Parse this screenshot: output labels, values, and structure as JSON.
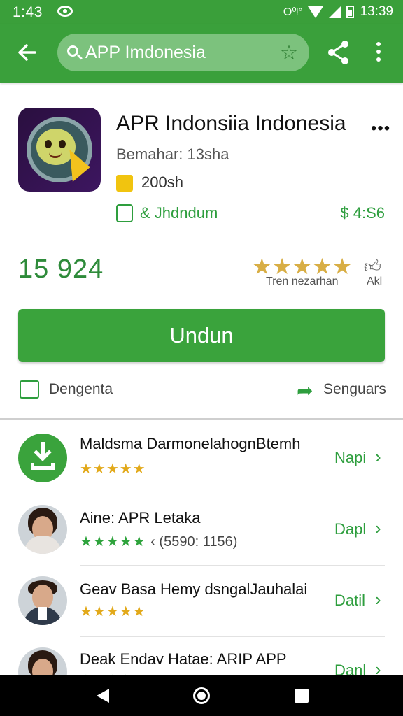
{
  "status_bar": {
    "time_left": "1:43",
    "right_glyphs": "O⁰ᵎᐤ",
    "time_right": "13:39"
  },
  "search": {
    "query": "APP Imdonesia"
  },
  "app": {
    "title": "APR Indonsiia Indonesia",
    "developer": "Bemahar: 13sha",
    "age_rating": "200sh",
    "category": "& Jhdndum",
    "price": "$ 4:S6",
    "rating_count": "15 924",
    "stars_caption": "Tren nezarhan",
    "stars_value": 4.5,
    "thumb_caption": "Akl",
    "install_label": "Undun",
    "action_left": "Dengenta",
    "action_right": "Senguars"
  },
  "list": [
    {
      "title": "Maldsma DarmonelahognBtemh",
      "stars": "★★★★★",
      "meta": "",
      "action": "Napi",
      "accent": "#e2a91a"
    },
    {
      "title": "Aine: APR Letaka",
      "stars": "★★★★★",
      "meta": "‹ (5590: 1156)",
      "action": "Dapl",
      "accent": "#2ea33c"
    },
    {
      "title": "Geav Basa Hemy dsngalJauhalai",
      "stars": "★★★★★",
      "meta": "",
      "action": "Datil",
      "accent": "#e2a91a"
    },
    {
      "title": "Deak Endav Hatae: ARIP APP",
      "stars": "★★★★★",
      "meta": "",
      "action": "Danl",
      "accent": "#2ea33c"
    }
  ],
  "icons": {
    "back": "arrow-left-icon",
    "search": "search-icon",
    "favorite": "star-icon",
    "share": "share-icon",
    "more": "more-vertical-icon",
    "chevron": "chevron-right-icon"
  },
  "colors": {
    "primary_green": "#3aa03b",
    "status_green": "#3a9f3a",
    "star_gold": "#d8ae45"
  }
}
